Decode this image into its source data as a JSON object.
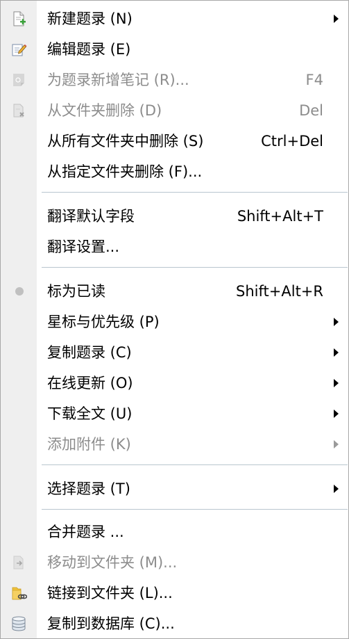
{
  "menu": {
    "items": [
      {
        "label": "新建题录 (N)",
        "shortcut": "",
        "icon": "new-record-icon",
        "submenu": true,
        "enabled": true
      },
      {
        "label": "编辑题录 (E)",
        "shortcut": "",
        "icon": "edit-record-icon",
        "submenu": false,
        "enabled": true
      },
      {
        "label": "为题录新增笔记 (R)...",
        "shortcut": "F4",
        "icon": "add-note-icon",
        "submenu": false,
        "enabled": false
      },
      {
        "label": "从文件夹删除 (D)",
        "shortcut": "Del",
        "icon": "delete-from-folder-icon",
        "submenu": false,
        "enabled": false
      },
      {
        "label": "从所有文件夹中删除 (S)",
        "shortcut": "Ctrl+Del",
        "icon": "",
        "submenu": false,
        "enabled": true
      },
      {
        "label": "从指定文件夹删除 (F)...",
        "shortcut": "",
        "icon": "",
        "submenu": false,
        "enabled": true
      },
      {
        "label": "翻译默认字段",
        "shortcut": "Shift+Alt+T",
        "icon": "",
        "submenu": false,
        "enabled": true
      },
      {
        "label": "翻译设置...",
        "shortcut": "",
        "icon": "",
        "submenu": false,
        "enabled": true
      },
      {
        "label": "标为已读",
        "shortcut": "Shift+Alt+R",
        "icon": "read-status-dot-icon",
        "submenu": false,
        "enabled": true
      },
      {
        "label": "星标与优先级 (P)",
        "shortcut": "",
        "icon": "",
        "submenu": true,
        "enabled": true
      },
      {
        "label": "复制题录 (C)",
        "shortcut": "",
        "icon": "",
        "submenu": true,
        "enabled": true
      },
      {
        "label": "在线更新 (O)",
        "shortcut": "",
        "icon": "",
        "submenu": true,
        "enabled": true
      },
      {
        "label": "下载全文 (U)",
        "shortcut": "",
        "icon": "",
        "submenu": true,
        "enabled": true
      },
      {
        "label": "添加附件 (K)",
        "shortcut": "",
        "icon": "",
        "submenu": true,
        "enabled": false
      },
      {
        "label": "选择题录 (T)",
        "shortcut": "",
        "icon": "",
        "submenu": true,
        "enabled": true
      },
      {
        "label": "合并题录 ...",
        "shortcut": "",
        "icon": "",
        "submenu": false,
        "enabled": true
      },
      {
        "label": "移动到文件夹 (M)...",
        "shortcut": "",
        "icon": "move-to-folder-icon",
        "submenu": false,
        "enabled": false
      },
      {
        "label": "链接到文件夹 (L)...",
        "shortcut": "",
        "icon": "link-folder-icon",
        "submenu": false,
        "enabled": true
      },
      {
        "label": "复制到数据库 (C)...",
        "shortcut": "",
        "icon": "database-icon",
        "submenu": false,
        "enabled": true
      }
    ]
  },
  "colors": {
    "gutter": "#efefef",
    "separator": "#b9c6cf",
    "disabled_text": "#8c8c8c",
    "accent_green": "#3aa13a",
    "folder_yellow": "#f0c33c"
  }
}
